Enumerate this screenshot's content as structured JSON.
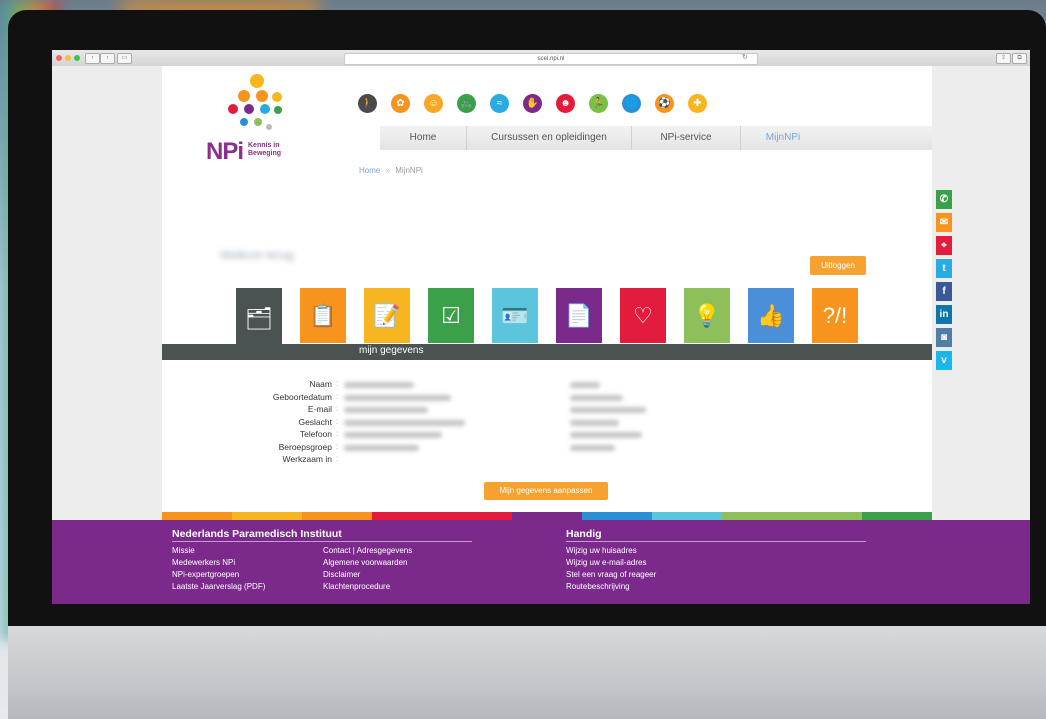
{
  "browser": {
    "url": "scel.npi.nl",
    "nav_back": "‹",
    "nav_forward": "›"
  },
  "logo": {
    "name": "NPi",
    "tagline_1": "Kennis in",
    "tagline_2": "Beweging"
  },
  "category_icons": [
    {
      "name": "walking-icon",
      "color": "#4a4a4a",
      "glyph": "🚶"
    },
    {
      "name": "sun-icon",
      "color": "#f7941d",
      "glyph": "✿"
    },
    {
      "name": "face-icon",
      "color": "#f7a823",
      "glyph": "☺"
    },
    {
      "name": "cycling-icon",
      "color": "#3aa14a",
      "glyph": "🚲"
    },
    {
      "name": "swimming-icon",
      "color": "#29abe2",
      "glyph": "≈"
    },
    {
      "name": "hand-icon",
      "color": "#7b2a8c",
      "glyph": "✋"
    },
    {
      "name": "head-icon",
      "color": "#e31b3c",
      "glyph": "☻"
    },
    {
      "name": "running-icon",
      "color": "#7ac143",
      "glyph": "🏃"
    },
    {
      "name": "globe-icon",
      "color": "#2b8fd6",
      "glyph": "🌐"
    },
    {
      "name": "sport-icon",
      "color": "#f7941d",
      "glyph": "⚽"
    },
    {
      "name": "plus-icon",
      "color": "#f7b520",
      "glyph": "✚"
    }
  ],
  "menu": {
    "home": "Home",
    "courses": "Cursussen en opleidingen",
    "service": "NPi-service",
    "mynpi": "MijnNPi"
  },
  "breadcrumb": {
    "home": "Home",
    "separator": "»",
    "current": "MijnNPi"
  },
  "welcome": "Welkom terug",
  "logout_label": "Uitloggen",
  "tiles": [
    {
      "name": "folder-icon",
      "color": "#4a5352",
      "glyph": "🗂"
    },
    {
      "name": "presentation-icon",
      "color": "#f7941d",
      "glyph": "📋"
    },
    {
      "name": "clipboard-icon",
      "color": "#f7b520",
      "glyph": "📝"
    },
    {
      "name": "checklist-icon",
      "color": "#3aa14a",
      "glyph": "☑"
    },
    {
      "name": "id-card-icon",
      "color": "#5bc5dd",
      "glyph": "🪪"
    },
    {
      "name": "document-icon",
      "color": "#7b2a8c",
      "glyph": "📄"
    },
    {
      "name": "heart-icon",
      "color": "#e31b3c",
      "glyph": "♡"
    },
    {
      "name": "lightbulb-icon",
      "color": "#8dc05a",
      "glyph": "💡"
    },
    {
      "name": "thumbs-up-icon",
      "color": "#4a90d9",
      "glyph": "👍"
    },
    {
      "name": "question-icon",
      "color": "#f7941d",
      "glyph": "?/!"
    }
  ],
  "section_title": "mijn gegevens",
  "fields": [
    "Naam",
    "Geboortedatum",
    "E-mail",
    "Geslacht",
    "Telefoon",
    "Beroepsgroep",
    "Werkzaam in"
  ],
  "edit_button": "Mijn gegevens aanpassen",
  "strip_colors": [
    "#f7941d",
    "#f7b520",
    "#f7941d",
    "#e31b3c",
    "#e31b3c",
    "#7b2a8c",
    "#2b8fd6",
    "#5bc5dd",
    "#8dc05a",
    "#8dc05a",
    "#3aa14a"
  ],
  "footer": {
    "left_title": "Nederlands Paramedisch Instituut",
    "col1": [
      "Missie",
      "Medewerkers NPi",
      "NPi-expertgroepen",
      "Laatste Jaarverslag (PDF)"
    ],
    "col2": [
      "Contact | Adresgegevens",
      "Algemene voorwaarden",
      "Disclaimer",
      "Klachtenprocedure"
    ],
    "right_title": "Handig",
    "col3": [
      "Wijzig uw huisadres",
      "Wijzig uw e-mail-adres",
      "Stel een vraag of reageer",
      "Routebeschrijving"
    ]
  },
  "social": [
    {
      "name": "phone-icon",
      "color": "#3aa14a",
      "glyph": "✆"
    },
    {
      "name": "mail-icon",
      "color": "#f7941d",
      "glyph": "✉"
    },
    {
      "name": "location-icon",
      "color": "#e31b3c",
      "glyph": "⌖"
    },
    {
      "name": "twitter-icon",
      "color": "#29abe2",
      "glyph": "t"
    },
    {
      "name": "facebook-icon",
      "color": "#3b5998",
      "glyph": "f"
    },
    {
      "name": "linkedin-icon",
      "color": "#0e76a8",
      "glyph": "in"
    },
    {
      "name": "instagram-icon",
      "color": "#517fa4",
      "glyph": "◙"
    },
    {
      "name": "vimeo-icon",
      "color": "#1ab7ea",
      "glyph": "v"
    }
  ]
}
